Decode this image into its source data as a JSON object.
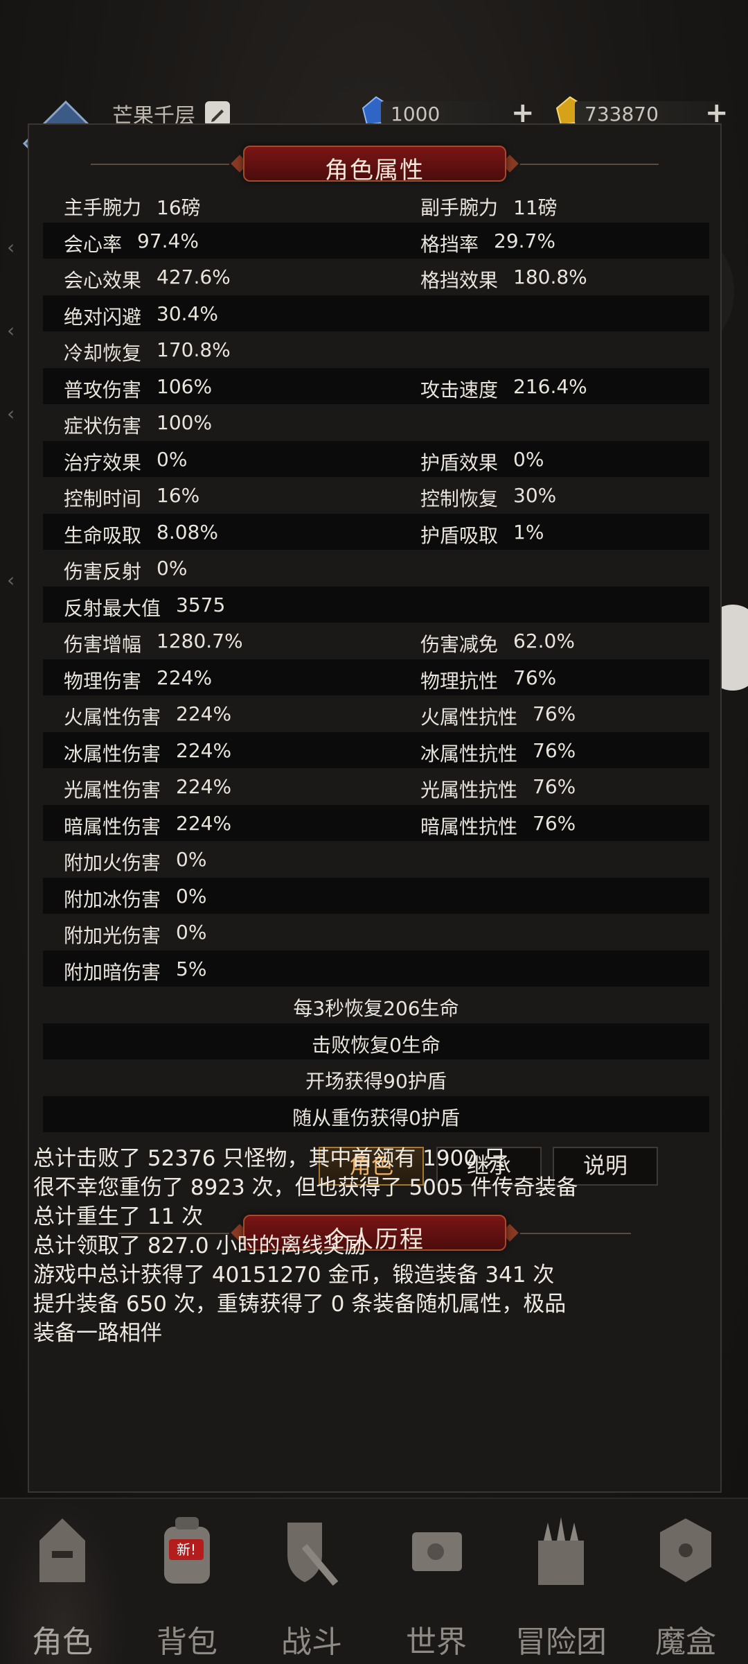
{
  "header": {
    "username": "芒果千层",
    "currency_blue": {
      "value": "1000",
      "icon": "blue-gem-icon"
    },
    "currency_gold": {
      "value": "733870",
      "icon": "gold-gem-icon"
    }
  },
  "attributes": {
    "title": "角色属性",
    "rows": [
      {
        "l1": "主手腕力",
        "v1": "16磅",
        "l2": "副手腕力",
        "v2": "11磅"
      },
      {
        "l1": "会心率",
        "v1": "97.4%",
        "l2": "格挡率",
        "v2": "29.7%"
      },
      {
        "l1": "会心效果",
        "v1": "427.6%",
        "l2": "格挡效果",
        "v2": "180.8%"
      },
      {
        "l1": "绝对闪避",
        "v1": "30.4%",
        "l2": "",
        "v2": ""
      },
      {
        "l1": "冷却恢复",
        "v1": "170.8%",
        "l2": "",
        "v2": ""
      },
      {
        "l1": "普攻伤害",
        "v1": "106%",
        "l2": "攻击速度",
        "v2": "216.4%"
      },
      {
        "l1": "症状伤害",
        "v1": "100%",
        "l2": "",
        "v2": ""
      },
      {
        "l1": "治疗效果",
        "v1": "0%",
        "l2": "护盾效果",
        "v2": "0%"
      },
      {
        "l1": "控制时间",
        "v1": "16%",
        "l2": "控制恢复",
        "v2": "30%"
      },
      {
        "l1": "生命吸取",
        "v1": "8.08%",
        "l2": "护盾吸取",
        "v2": "1%"
      },
      {
        "l1": "伤害反射",
        "v1": "0%",
        "l2": "",
        "v2": ""
      },
      {
        "l1": "反射最大值",
        "v1": "3575",
        "l2": "",
        "v2": ""
      },
      {
        "l1": "伤害增幅",
        "v1": "1280.7%",
        "l2": "伤害减免",
        "v2": "62.0%"
      },
      {
        "l1": "物理伤害",
        "v1": "224%",
        "l2": "物理抗性",
        "v2": "76%"
      },
      {
        "l1": "火属性伤害",
        "v1": "224%",
        "l2": "火属性抗性",
        "v2": "76%"
      },
      {
        "l1": "冰属性伤害",
        "v1": "224%",
        "l2": "冰属性抗性",
        "v2": "76%"
      },
      {
        "l1": "光属性伤害",
        "v1": "224%",
        "l2": "光属性抗性",
        "v2": "76%"
      },
      {
        "l1": "暗属性伤害",
        "v1": "224%",
        "l2": "暗属性抗性",
        "v2": "76%"
      },
      {
        "l1": "附加火伤害",
        "v1": "0%",
        "l2": "",
        "v2": ""
      },
      {
        "l1": "附加冰伤害",
        "v1": "0%",
        "l2": "",
        "v2": ""
      },
      {
        "l1": "附加光伤害",
        "v1": "0%",
        "l2": "",
        "v2": ""
      },
      {
        "l1": "附加暗伤害",
        "v1": "5%",
        "l2": "",
        "v2": ""
      }
    ],
    "summary": [
      "每3秒恢复206生命",
      "击败恢复0生命",
      "开场获得90护盾",
      "随从重伤获得0护盾"
    ]
  },
  "tabs": {
    "role": "角色",
    "inherit": "继承",
    "explain": "说明",
    "active": "role"
  },
  "history": {
    "title": "个人历程",
    "lines": [
      "总计击败了 52376 只怪物，其中首领有 1900 只",
      "很不幸您重伤了 8923 次，但也获得了 5005 件传奇装备",
      "总计重生了 11 次",
      "总计领取了 827.0 小时的离线奖励",
      "游戏中总计获得了 40151270 金币，锻造装备 341 次",
      "提升装备 650 次，重铸获得了 0 条装备随机属性，极品",
      "装备一路相伴"
    ]
  },
  "nav": {
    "items": [
      {
        "label": "角色",
        "icon": "helmet-icon"
      },
      {
        "label": "背包",
        "icon": "backpack-icon",
        "badge": "新!"
      },
      {
        "label": "战斗",
        "icon": "shield-sword-icon"
      },
      {
        "label": "世界",
        "icon": "map-scroll-icon"
      },
      {
        "label": "冒险团",
        "icon": "castle-icon"
      },
      {
        "label": "魔盒",
        "icon": "cube-box-icon"
      }
    ],
    "active": "角色"
  },
  "colors": {
    "accent_gold": "#f1b36a",
    "ribbon_red": "#7a1515",
    "row_dark": "#0c0b0b",
    "panel": "#1b1918"
  }
}
